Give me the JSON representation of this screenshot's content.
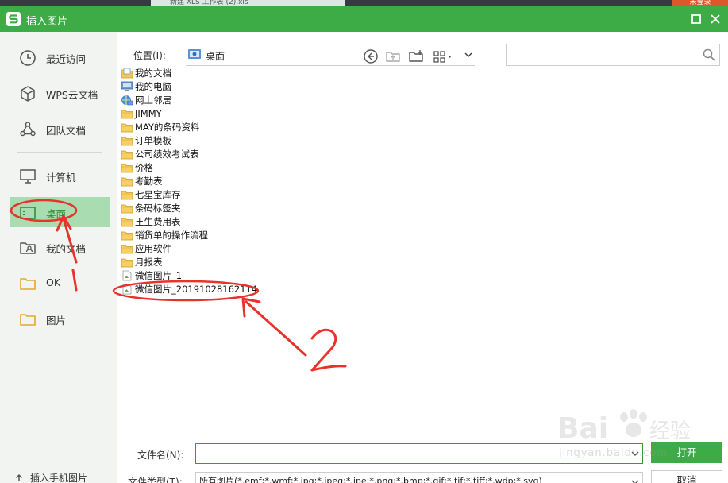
{
  "taskbar": {
    "tab_label": "新建 XLS 工作表 (2).xls",
    "login_label": "未登录"
  },
  "dialog": {
    "title": "插入图片"
  },
  "sidebar": {
    "items": [
      {
        "label": "最近访问",
        "icon": "clock-icon"
      },
      {
        "label": "WPS云文档",
        "icon": "cube-icon"
      },
      {
        "label": "团队文档",
        "icon": "team-icon"
      },
      {
        "label": "计算机",
        "icon": "monitor-icon"
      },
      {
        "label": "桌面",
        "icon": "desktop-icon",
        "active": true
      },
      {
        "label": "我的文档",
        "icon": "person-folder-icon"
      },
      {
        "label": "OK",
        "icon": "folder-icon"
      },
      {
        "label": "图片",
        "icon": "folder-icon"
      }
    ],
    "phone_label": "插入手机图片"
  },
  "location": {
    "label": "位置(I):",
    "value": "桌面"
  },
  "search": {
    "placeholder": ""
  },
  "files": [
    {
      "name": "我的文档",
      "icon": "documents-icon"
    },
    {
      "name": "我的电脑",
      "icon": "computer-icon"
    },
    {
      "name": "网上邻居",
      "icon": "network-icon"
    },
    {
      "name": "JIMMY",
      "icon": "folder-icon"
    },
    {
      "name": "MAY的条码资料",
      "icon": "folder-icon"
    },
    {
      "name": "订单模板",
      "icon": "folder-icon"
    },
    {
      "name": "公司绩效考试表",
      "icon": "folder-icon"
    },
    {
      "name": "价格",
      "icon": "folder-icon"
    },
    {
      "name": "考勤表",
      "icon": "folder-icon"
    },
    {
      "name": "七星宝库存",
      "icon": "folder-icon"
    },
    {
      "name": "条码标签夹",
      "icon": "folder-icon"
    },
    {
      "name": "王生费用表",
      "icon": "folder-icon"
    },
    {
      "name": "销货单的操作流程",
      "icon": "folder-icon"
    },
    {
      "name": "应用软件",
      "icon": "folder-icon"
    },
    {
      "name": "月报表",
      "icon": "folder-icon"
    },
    {
      "name": "微信图片_1",
      "icon": "image-file-icon"
    },
    {
      "name": "微信图片_20191028162114",
      "icon": "image-file-icon"
    }
  ],
  "footer": {
    "filename_label": "文件名(N):",
    "filename_value": "",
    "filetype_label": "文件类型(T):",
    "filetype_value": "所有图片(*.emf;*.wmf;*.jpg;*.jpeg;*.jpe;*.png;*.bmp;*.gif;*.tif;*.tiff;*.wdp;*.svg)",
    "open_label": "打开",
    "cancel_label": "取消"
  },
  "watermark": {
    "text": "jingyan.baidu.com"
  },
  "colors": {
    "accent": "#3dab46",
    "sidebar_active": "#a9dcb0",
    "annotation": "#e8322c"
  }
}
